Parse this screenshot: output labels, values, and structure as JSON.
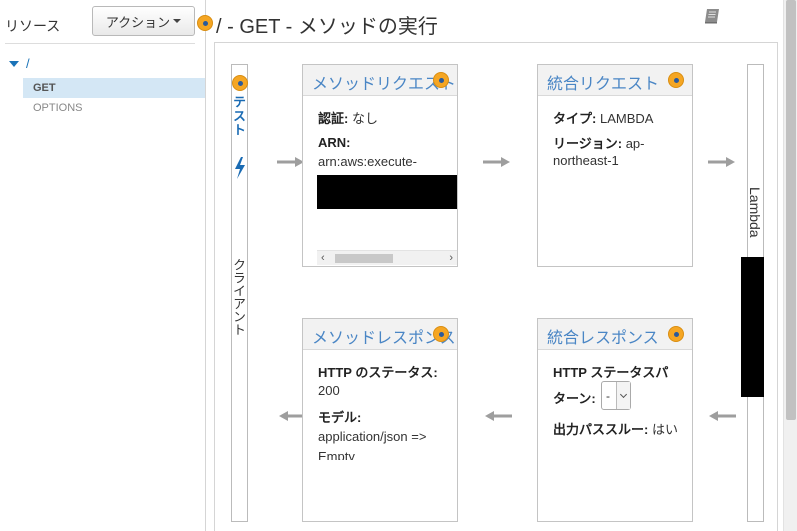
{
  "sidebar": {
    "resources_label": "リソース",
    "actions_button": "アクション",
    "tree_root": "/",
    "items": [
      {
        "label": "GET",
        "selected": true
      },
      {
        "label": "OPTIONS",
        "selected": false
      }
    ]
  },
  "header": {
    "title": "/ - GET - メソッドの実行"
  },
  "client": {
    "test_label": "テスト",
    "client_label": "クライアント"
  },
  "method_request": {
    "title": "メソッドリクエスト",
    "auth_key": "認証:",
    "auth_value": "なし",
    "arn_key": "ARN:",
    "arn_value": "arn:aws:execute-"
  },
  "integration_request": {
    "title": "統合リクエスト",
    "type_key": "タイプ:",
    "type_value": "LAMBDA",
    "region_key": "リージョン:",
    "region_value_1": "ap-",
    "region_value_2": "northeast-1"
  },
  "method_response": {
    "title": "メソッドレスポンス",
    "status_key": "HTTP のステータス:",
    "status_value": "200",
    "model_key": "モデル:",
    "model_value_1": "application/json =>",
    "model_value_2": "Empty"
  },
  "integration_response": {
    "title": "統合レスポンス",
    "pattern_key_1": "HTTP ステータスパ",
    "pattern_key_2": "ターン:",
    "pattern_select_value": "-",
    "passthrough_key": "出力パススルー:",
    "passthrough_value": "はい"
  },
  "lambda": {
    "label": "Lambda"
  },
  "colors": {
    "accent": "#4a86c5",
    "help_dot": "#f5a623",
    "selected_row": "#d4e7f5",
    "arrow": "#9e9e9e"
  }
}
